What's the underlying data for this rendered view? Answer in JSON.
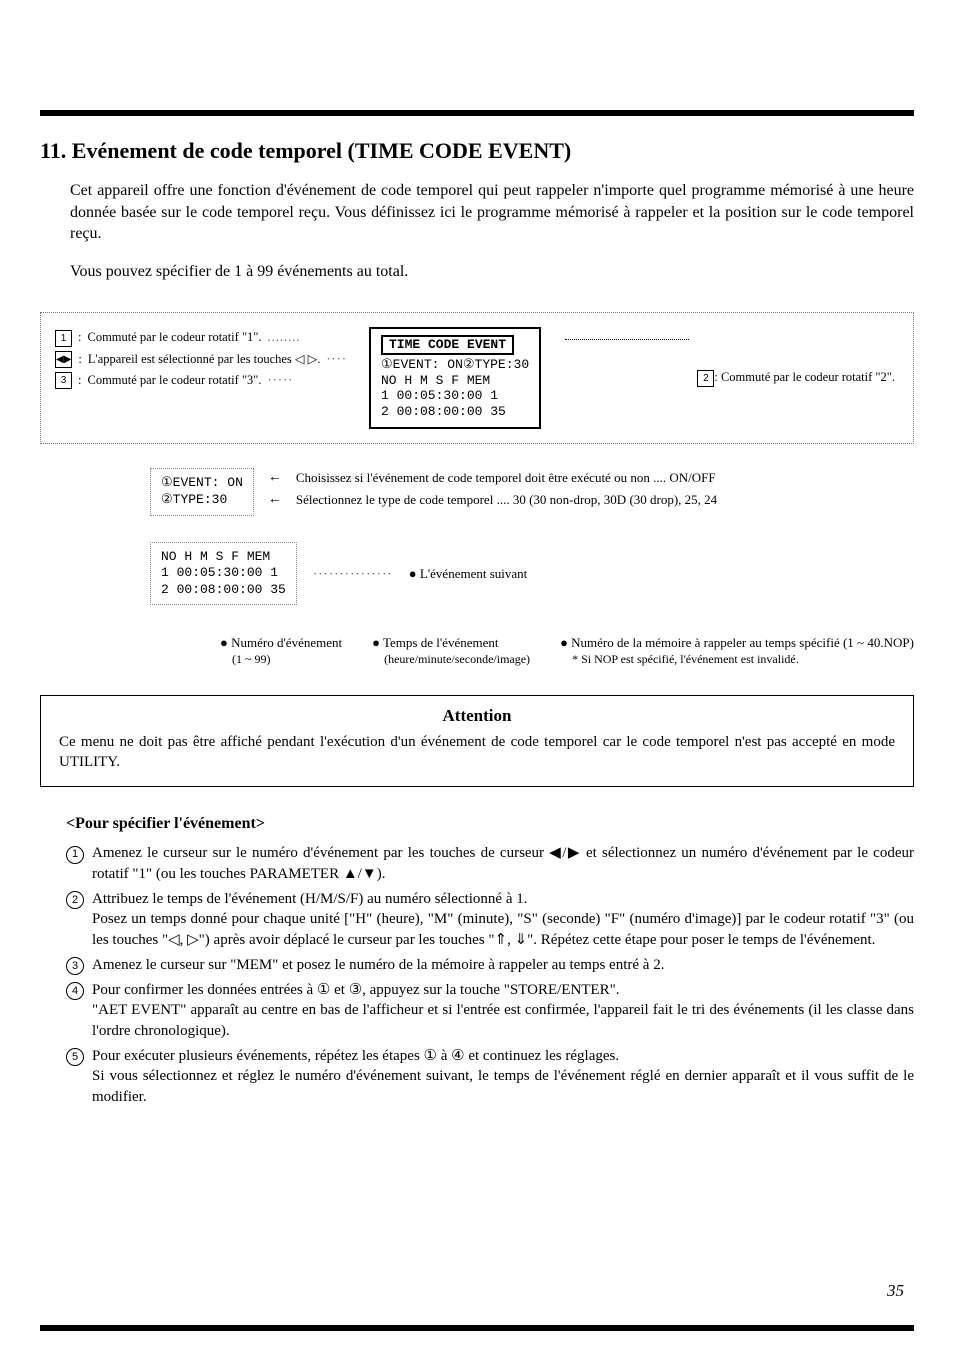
{
  "heading": "11.  Evénement de code temporel (TIME CODE EVENT)",
  "intro_p1": "Cet appareil offre une fonction d'événement de code temporel qui peut rappeler n'importe quel programme mémorisé à une heure donnée basée sur le code temporel reçu. Vous définissez ici le programme mémorisé à rappeler et la position sur le code temporel reçu.",
  "intro_p2": "Vous pouvez spécifier de 1 à 99 événements au total.",
  "left": {
    "a": "Commuté par le codeur rotatif \"1\".",
    "b": "L'appareil est sélectionné par les touches ◁ ▷.",
    "c": "Commuté par le codeur rotatif \"3\"."
  },
  "right_label": "Commuté par le codeur rotatif \"2\".",
  "lcd": {
    "title": "TIME CODE EVENT",
    "line1": "①EVENT: ON②TYPE:30",
    "line2": "  NO  H   M   S   F  MEM",
    "line3": "   1 00:05:30:00   1",
    "line4": "   2 00:08:00:00  35"
  },
  "sub1": {
    "box_l1": "①EVENT: ON",
    "box_l2": "②TYPE:30",
    "desc1": "Choisissez si l'événement de code temporel doit être exécuté ou non .... ON/OFF",
    "desc2": "Sélectionnez le type de code temporel .... 30 (30 non-drop, 30D (30 drop), 25, 24"
  },
  "sub2": {
    "box_l1": "  NO  H   M   S   F  MEM",
    "box_l2": "   1 00:05:30:00   1",
    "box_l3": "   2 00:08:00:00  35",
    "next": "● L'événement suivant"
  },
  "legend": {
    "a": "● Numéro d'événement",
    "a2": "(1 ~ 99)",
    "b": "● Temps de l'événement",
    "b2": "(heure/minute/seconde/image)",
    "c": "● Numéro de la mémoire à rappeler au temps spécifié (1 ~ 40.NOP)",
    "c2": "* Si NOP est spécifié, l'événement est invalidé."
  },
  "attention": {
    "title": "Attention",
    "body": "Ce menu ne doit pas être affiché pendant l'exécution d'un événement de code temporel car le code temporel n'est pas accepté en mode UTILITY."
  },
  "spec": {
    "title": "<Pour spécifier l'événement>",
    "s1": "Amenez le curseur sur le numéro d'événement par les touches de curseur ◀/▶ et sélectionnez un numéro d'événement par le codeur rotatif \"1\" (ou les touches PARAMETER ▲/▼).",
    "s2": "Attribuez le temps de l'événement (H/M/S/F) au numéro sélectionné à 1.\nPosez un temps donné pour chaque unité [\"H\" (heure), \"M\" (minute), \"S\" (seconde) \"F\" (numéro d'image)] par le codeur rotatif \"3\" (ou les touches \"◁, ▷\") après avoir déplacé le curseur par les touches \"⇑, ⇓\". Répétez cette étape pour poser le temps de l'événement.",
    "s3": "Amenez le curseur sur \"MEM\" et posez le numéro de la mémoire à rappeler au temps entré à 2.",
    "s4": "Pour confirmer les données entrées à ① et ③, appuyez sur la touche \"STORE/ENTER\".\n\"AET EVENT\" apparaît au centre en bas de l'afficheur et si l'entrée est confirmée, l'appareil fait le tri des événements (il les classe dans l'ordre chronologique).",
    "s5": "Pour exécuter plusieurs événements, répétez les étapes ① à ④ et continuez les réglages.\nSi vous sélectionnez et réglez le numéro d'événement suivant, le temps de l'événement réglé en dernier apparaît et il vous suffit de le modifier."
  },
  "pagenum": "35"
}
